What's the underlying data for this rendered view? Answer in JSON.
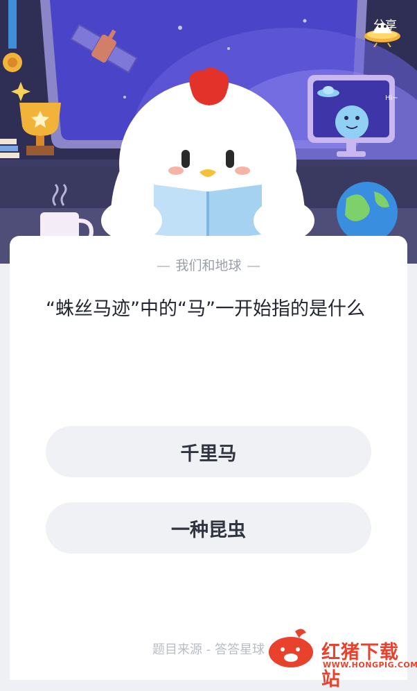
{
  "header": {
    "share_label": "分享",
    "tv_greeting": "Hi~"
  },
  "quiz": {
    "category": "我们和地球",
    "question": "“蛛丝马迹”中的“马”一开始指的是什么",
    "options": [
      {
        "label": "千里马"
      },
      {
        "label": "一种昆虫"
      }
    ],
    "source": "题目来源 - 答答星球"
  },
  "watermark": {
    "title": "红猪下载站",
    "url": "WWW.HONGPIG.COM"
  },
  "colors": {
    "accent_red": "#e8412c",
    "scene_dark": "#2b2b4e",
    "window_purple": "#4a45c8",
    "option_bg": "#eff1f4"
  }
}
